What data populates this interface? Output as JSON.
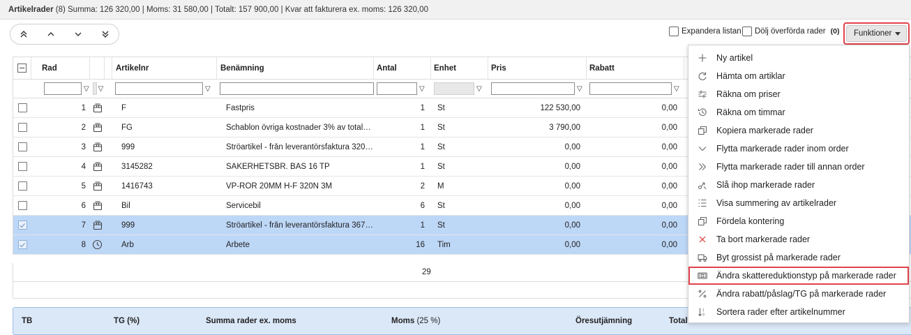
{
  "summary": {
    "title": "Artikelrader",
    "text": " (8) Summa: 126 320,00 | Moms: 31 580,00 | Totalt: 157 900,00 | Kvar att fakturera ex. moms: 126 320,00"
  },
  "toolbar": {
    "nav_icons": [
      "double-chevron-up-icon",
      "chevron-up-icon",
      "chevron-down-icon",
      "double-chevron-down-icon"
    ],
    "expand_label": "Expandera listan",
    "hide_label": "Dölj överförda rader",
    "hide_count": "(0)",
    "functions_label": "Funktioner"
  },
  "grid": {
    "headers": {
      "rad": "Rad",
      "artikelnr": "Artikelnr",
      "benamning": "Benämning",
      "antal": "Antal",
      "enhet": "Enhet",
      "pris": "Pris",
      "rabatt": "Rabatt"
    },
    "rows": [
      {
        "rad": "1",
        "type": "package",
        "artikelnr": "F",
        "benamning": "Fastpris",
        "antal": "1",
        "enhet": "St",
        "pris": "122 530,00",
        "rabatt": "0,00",
        "selected": false
      },
      {
        "rad": "2",
        "type": "package",
        "artikelnr": "FG",
        "benamning": "Schablon övriga kostnader 3% av totalan...",
        "antal": "1",
        "enhet": "St",
        "pris": "3 790,00",
        "rabatt": "0,00",
        "selected": false
      },
      {
        "rad": "3",
        "type": "package",
        "artikelnr": "999",
        "benamning": "Ströartikel - från leverantörsfaktura 3209...",
        "antal": "1",
        "enhet": "St",
        "pris": "0,00",
        "rabatt": "0,00",
        "selected": false
      },
      {
        "rad": "4",
        "type": "package",
        "artikelnr": "3145282",
        "benamning": "SÄKERHETSBR. BAS 16 TP",
        "antal": "1",
        "enhet": "St",
        "pris": "0,00",
        "rabatt": "0,00",
        "selected": false
      },
      {
        "rad": "5",
        "type": "package",
        "artikelnr": "1416743",
        "benamning": "VP-RÖR 20MM H-F 320N 3M",
        "antal": "2",
        "enhet": "M",
        "pris": "0,00",
        "rabatt": "0,00",
        "selected": false
      },
      {
        "rad": "6",
        "type": "package",
        "artikelnr": "Bil",
        "benamning": "Servicebil",
        "antal": "6",
        "enhet": "St",
        "pris": "0,00",
        "rabatt": "0,00",
        "selected": false
      },
      {
        "rad": "7",
        "type": "package",
        "artikelnr": "999",
        "benamning": "Ströartikel - från leverantörsfaktura 3670...",
        "antal": "1",
        "enhet": "St",
        "pris": "0,00",
        "rabatt": "0,00",
        "selected": true
      },
      {
        "rad": "8",
        "type": "clock",
        "artikelnr": "Arb",
        "benamning": "Arbete",
        "antal": "16",
        "enhet": "Tim",
        "pris": "0,00",
        "rabatt": "0,00",
        "selected": true
      }
    ],
    "sum_antal": "29"
  },
  "totals": {
    "tb": "TB",
    "tg": "TG (%)",
    "summa": "Summa rader ex. moms",
    "moms": "Moms",
    "moms_rate": "(25 %)",
    "ores": "Öresutjämning",
    "totalt": "Totalt"
  },
  "menu": {
    "items": [
      {
        "label": "Ny artikel",
        "icon": "plus-icon",
        "highlighted": false
      },
      {
        "label": "Hämta om artiklar",
        "icon": "refresh-icon",
        "highlighted": false
      },
      {
        "label": "Räkna om priser",
        "icon": "adjust-icon",
        "highlighted": false
      },
      {
        "label": "Räkna om timmar",
        "icon": "history-icon",
        "highlighted": false
      },
      {
        "label": "Kopiera markerade rader",
        "icon": "copy-icon",
        "highlighted": false
      },
      {
        "label": "Flytta markerade rader inom order",
        "icon": "chevron-down-icon",
        "highlighted": false
      },
      {
        "label": "Flytta markerade rader till annan order",
        "icon": "double-chevron-right-icon",
        "highlighted": false
      },
      {
        "label": "Slå ihop markerade rader",
        "icon": "merge-icon",
        "highlighted": false
      },
      {
        "label": "Visa summering av artikelrader",
        "icon": "list-icon",
        "highlighted": false
      },
      {
        "label": "Fördela kontering",
        "icon": "copy-icon",
        "highlighted": false
      },
      {
        "label": "Ta bort markerade rader",
        "icon": "close-icon",
        "highlighted": false
      },
      {
        "label": "Byt grossist på markerade rader",
        "icon": "truck-icon",
        "highlighted": false
      },
      {
        "label": "Ändra skattereduktionstyp på markerade rader",
        "icon": "money-icon",
        "highlighted": true
      },
      {
        "label": "Ändra rabatt/påslag/TG på markerade rader",
        "icon": "percent-icon",
        "highlighted": false
      },
      {
        "label": "Sortera rader efter artikelnummer",
        "icon": "sort-icon",
        "highlighted": false
      }
    ]
  }
}
